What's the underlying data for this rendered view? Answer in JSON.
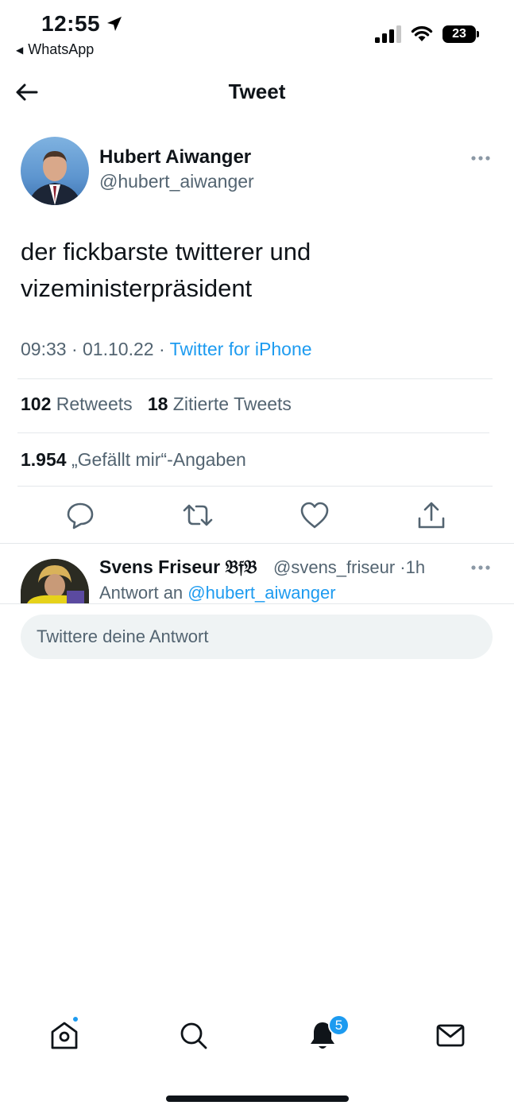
{
  "status_bar": {
    "time": "12:55",
    "back_app": "WhatsApp",
    "battery": "23"
  },
  "header": {
    "title": "Tweet"
  },
  "tweet": {
    "author_name": "Hubert Aiwanger",
    "author_handle": "@hubert_aiwanger",
    "text": "der fickbarste twitterer und vizeministerpräsident",
    "time": "09:33",
    "date": "01.10.22",
    "source": "Twitter for iPhone",
    "retweets_count": "102",
    "retweets_label": "Retweets",
    "quotes_count": "18",
    "quotes_label": "Zitierte Tweets",
    "likes_count": "1.954",
    "likes_label": "„Gefällt mir“-Angaben"
  },
  "reply": {
    "author_name": "Svens Friseur 𝔅𝔣𝔅",
    "author_handle": "@svens_friseur",
    "age": "1h",
    "reply_prefix": "Antwort an",
    "reply_mention": "@hubert_aiwanger"
  },
  "compose": {
    "placeholder": "Twittere deine Antwort"
  },
  "bottom_nav": {
    "notifications_badge": "5"
  },
  "colors": {
    "accent": "#1d9bf0",
    "text_primary": "#0f1419",
    "text_secondary": "#536471",
    "divider": "#e4e8eb",
    "compose_bg": "#eff3f4"
  }
}
